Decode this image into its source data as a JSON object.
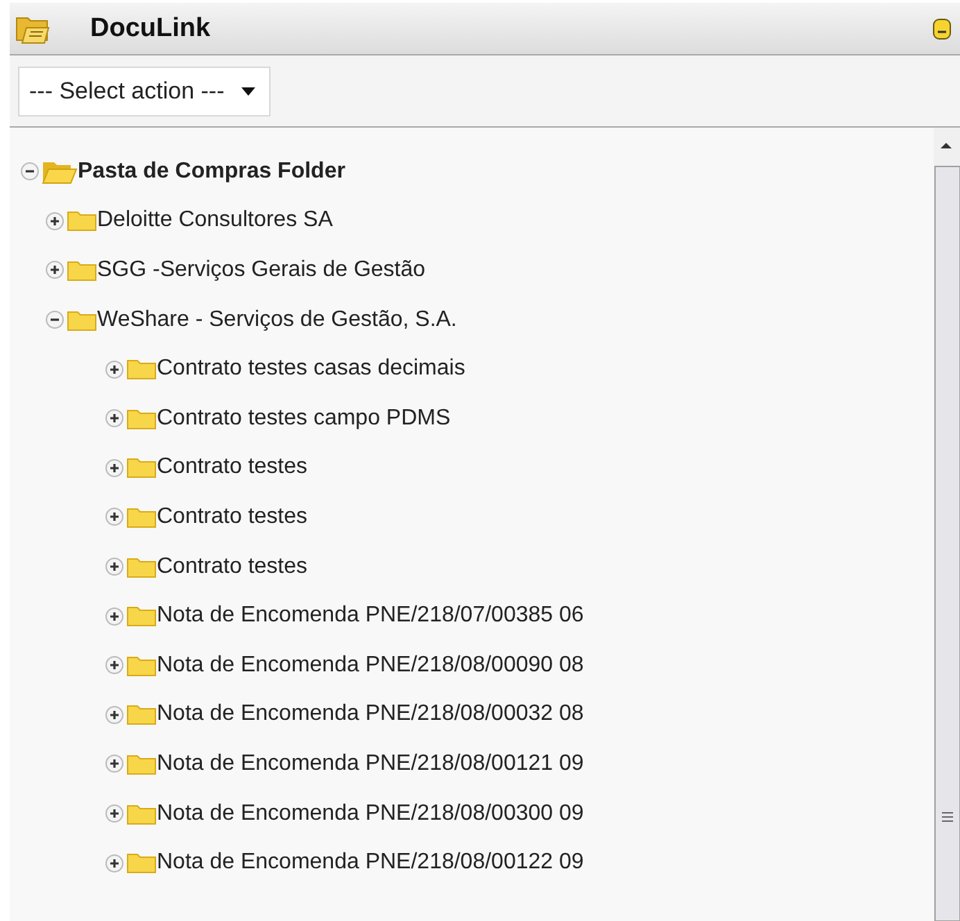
{
  "panel": {
    "title": "DocuLink"
  },
  "action_select": {
    "value": "--- Select action ---"
  },
  "tree": [
    {
      "label": "Pasta de Compras Folder",
      "expanded": true,
      "children": [
        {
          "label": "Deloitte Consultores SA",
          "expanded": false
        },
        {
          "label": "SGG -Serviços Gerais de Gestão",
          "expanded": false
        },
        {
          "label": "WeShare - Serviços de Gestão, S.A.",
          "expanded": true,
          "children": [
            {
              "label": "Contrato testes casas decimais",
              "expanded": false
            },
            {
              "label": "Contrato testes campo PDMS",
              "expanded": false
            },
            {
              "label": "Contrato testes",
              "expanded": false
            },
            {
              "label": "Contrato testes",
              "expanded": false
            },
            {
              "label": "Contrato testes",
              "expanded": false
            },
            {
              "label": "Nota de Encomenda PNE/218/07/00385 06",
              "expanded": false
            },
            {
              "label": "Nota de Encomenda PNE/218/08/00090 08",
              "expanded": false
            },
            {
              "label": "Nota de Encomenda PNE/218/08/00032 08",
              "expanded": false
            },
            {
              "label": "Nota de Encomenda PNE/218/08/00121 09",
              "expanded": false
            },
            {
              "label": "Nota de Encomenda PNE/218/08/00300 09",
              "expanded": false
            },
            {
              "label": "Nota de Encomenda PNE/218/08/00122 09",
              "expanded": false
            }
          ]
        }
      ]
    }
  ]
}
